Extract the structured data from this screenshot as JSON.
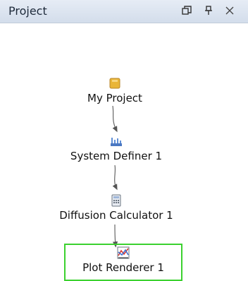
{
  "panel": {
    "title": "Project",
    "controls": [
      {
        "name": "restore-button",
        "icon": "restore-window-icon"
      },
      {
        "name": "pin-button",
        "icon": "pin-icon"
      },
      {
        "name": "close-button",
        "icon": "close-icon"
      }
    ]
  },
  "graph": {
    "nodes": [
      {
        "id": "my-project",
        "label": "My Project",
        "icon": "project-folder-icon"
      },
      {
        "id": "system-definer",
        "label": "System Definer 1",
        "icon": "system-definer-icon"
      },
      {
        "id": "diffusion-calculator",
        "label": "Diffusion Calculator 1",
        "icon": "calculator-icon"
      },
      {
        "id": "plot-renderer",
        "label": "Plot Renderer 1",
        "icon": "plot-icon"
      }
    ],
    "selected_node": "Plot Renderer 1",
    "selection_color": "#3bd12f"
  }
}
